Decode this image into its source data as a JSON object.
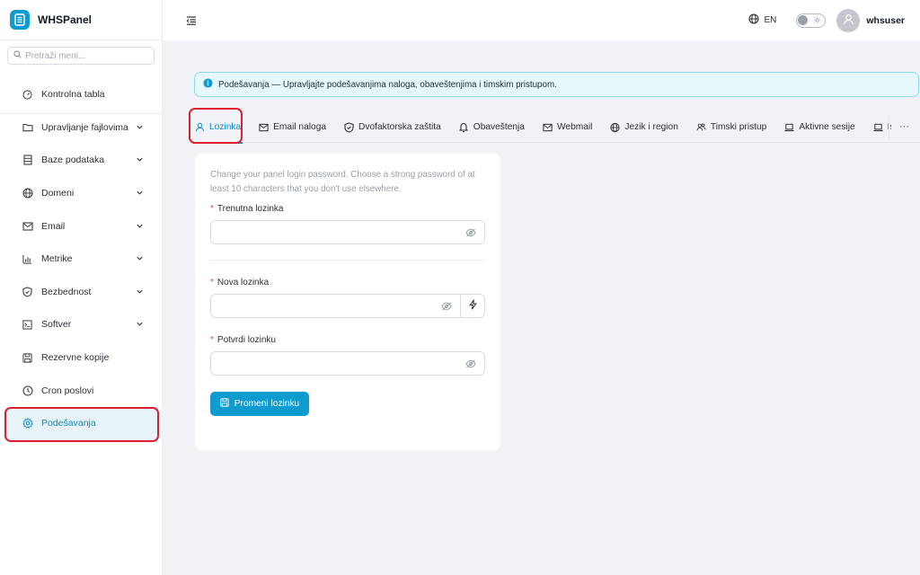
{
  "brand": {
    "name": "WHSPanel"
  },
  "sidebar": {
    "search_placeholder": "Pretraži meni...",
    "items": [
      {
        "label": "Kontrolna tabla",
        "icon": "dashboard-icon",
        "expandable": false
      },
      {
        "label": "Upravljanje fajlovima",
        "icon": "folder-icon",
        "expandable": true
      },
      {
        "label": "Baze podataka",
        "icon": "database-icon",
        "expandable": true
      },
      {
        "label": "Domeni",
        "icon": "globe-icon",
        "expandable": true
      },
      {
        "label": "Email",
        "icon": "mail-icon",
        "expandable": true
      },
      {
        "label": "Metrike",
        "icon": "bar-chart-icon",
        "expandable": true
      },
      {
        "label": "Bezbednost",
        "icon": "shield-icon",
        "expandable": true
      },
      {
        "label": "Softver",
        "icon": "terminal-icon",
        "expandable": true
      },
      {
        "label": "Rezervne kopije",
        "icon": "save-icon",
        "expandable": false
      },
      {
        "label": "Cron poslovi",
        "icon": "clock-icon",
        "expandable": false
      },
      {
        "label": "Podešavanja",
        "icon": "gear-icon",
        "expandable": false,
        "active": true
      }
    ]
  },
  "header": {
    "language": "EN",
    "username": "whsuser"
  },
  "alert": {
    "text": "Podešavanja — Upravljajte podešavanjima naloga, obaveštenjima i timskim pristupom."
  },
  "tabs": [
    {
      "label": "Lozinka",
      "icon": "user-icon",
      "active": true
    },
    {
      "label": "Email naloga",
      "icon": "mail-icon"
    },
    {
      "label": "Dvofaktorska zaštita",
      "icon": "shield-check-icon"
    },
    {
      "label": "Obaveštenja",
      "icon": "bell-icon"
    },
    {
      "label": "Webmail",
      "icon": "mail-icon"
    },
    {
      "label": "Jezik i region",
      "icon": "globe-icon"
    },
    {
      "label": "Timski pristup",
      "icon": "team-icon"
    },
    {
      "label": "Aktivne sesije",
      "icon": "laptop-icon"
    },
    {
      "label": "Is",
      "icon": "laptop-icon"
    }
  ],
  "tabs_more": "···",
  "form": {
    "description": "Change your panel login password. Choose a strong password of at least 10 characters that you don't use elsewhere.",
    "required_mark": "*",
    "current_label": "Trenutna lozinka",
    "new_label": "Nova lozinka",
    "confirm_label": "Potvrdi lozinku",
    "current_value": "",
    "new_value": "",
    "confirm_value": "",
    "submit_label": "Promeni lozinku"
  },
  "colors": {
    "accent": "#0e9bd0",
    "highlight": "#e11d2e",
    "alert_bg": "#e6f8fb"
  }
}
